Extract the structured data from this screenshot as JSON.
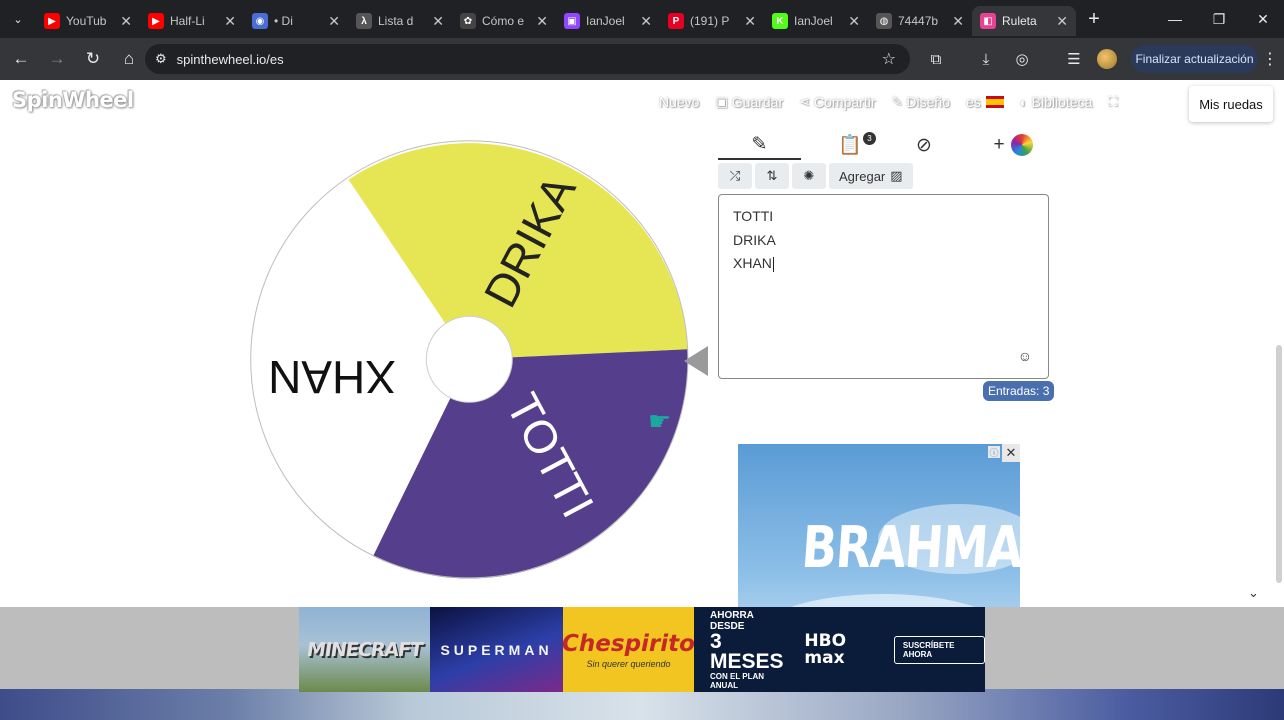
{
  "browser": {
    "tabs": [
      {
        "label": "YouTub",
        "favicon_color": "#ff0000",
        "favicon_glyph": "▶"
      },
      {
        "label": "Half-Li",
        "favicon_color": "#ff0000",
        "favicon_glyph": "▶"
      },
      {
        "label": "• Di",
        "favicon_color": "#4a6cd4",
        "favicon_glyph": "◉"
      },
      {
        "label": "Lista d",
        "favicon_color": "#555555",
        "favicon_glyph": "λ"
      },
      {
        "label": "Cómo e",
        "favicon_color": "#444444",
        "favicon_glyph": "✿"
      },
      {
        "label": "IanJoel",
        "favicon_color": "#9146ff",
        "favicon_glyph": "▣"
      },
      {
        "label": "(191) P",
        "favicon_color": "#e60023",
        "favicon_glyph": "P"
      },
      {
        "label": "IanJoel",
        "favicon_color": "#53fc18",
        "favicon_glyph": "K"
      },
      {
        "label": "74447b",
        "favicon_color": "#555555",
        "favicon_glyph": "◍"
      },
      {
        "label": "Ruleta",
        "favicon_color": "#e84393",
        "favicon_glyph": "◧"
      }
    ],
    "url": "spinthewheel.io/es",
    "update_button": "Finalizar actualización"
  },
  "header": {
    "logo": "SpinWheel",
    "menu": {
      "nuevo": "Nuevo",
      "guardar": "Guardar",
      "compartir": "Compartir",
      "diseno": "Diseño",
      "lang": "es",
      "biblioteca": "Biblioteca"
    },
    "mis_ruedas": "Mis ruedas"
  },
  "wheel": {
    "segments": [
      {
        "label": "DRIKA",
        "color": "#e6e655",
        "text_color": "#222222"
      },
      {
        "label": "TOTTI",
        "color": "#553f8c",
        "text_color": "#ffffff"
      },
      {
        "label": "XHAN",
        "color": "#ffffff",
        "text_color": "#111111"
      }
    ]
  },
  "editor": {
    "tabs": [
      "edit-icon",
      "list-icon",
      "hide-icon",
      "add-color-icon"
    ],
    "list_badge": "3",
    "toolbar": {
      "agregar": "Agregar"
    },
    "entries": [
      "TOTTI",
      "DRIKA",
      "XHAN"
    ],
    "entries_count": "Entradas: 3"
  },
  "ads": {
    "right_brand": "BRAHMA",
    "bottom": {
      "minecraft": "MINECRAFT",
      "superman": "SUPERMAN",
      "chespirito_title": "Chespirito",
      "chespirito_sub": "Sin querer queriendo",
      "hbo_line1": "AHORRA DESDE",
      "hbo_line2": "3 MESES",
      "hbo_line3": "CON EL PLAN ANUAL",
      "hbo_logo": "HBO max",
      "hbo_cta": "SUSCRÍBETE AHORA"
    }
  },
  "colors": {
    "accent": "#4a6faf",
    "chrome_dark": "#202124",
    "chrome_mid": "#35363a"
  }
}
